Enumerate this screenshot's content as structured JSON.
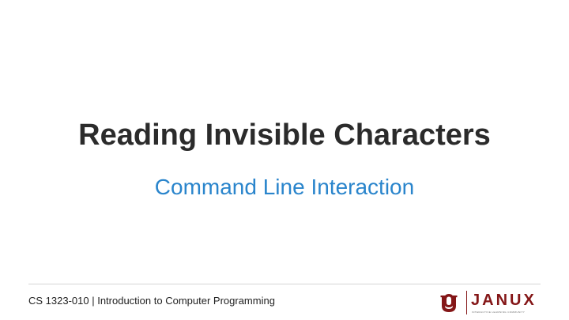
{
  "slide": {
    "title": "Reading Invisible Characters",
    "subtitle": "Command Line Interaction"
  },
  "footer": {
    "course": "CS 1323-010 | Introduction to Computer Programming",
    "logos": {
      "ou": "ou-logo",
      "janux_name": "JANUX",
      "janux_tagline": "INTERACTIVE LEARNING COMMUNITY"
    }
  },
  "colors": {
    "title": "#2b2b2b",
    "subtitle": "#2a85cc",
    "brand_crimson": "#841617",
    "divider": "#d4d4d4"
  }
}
